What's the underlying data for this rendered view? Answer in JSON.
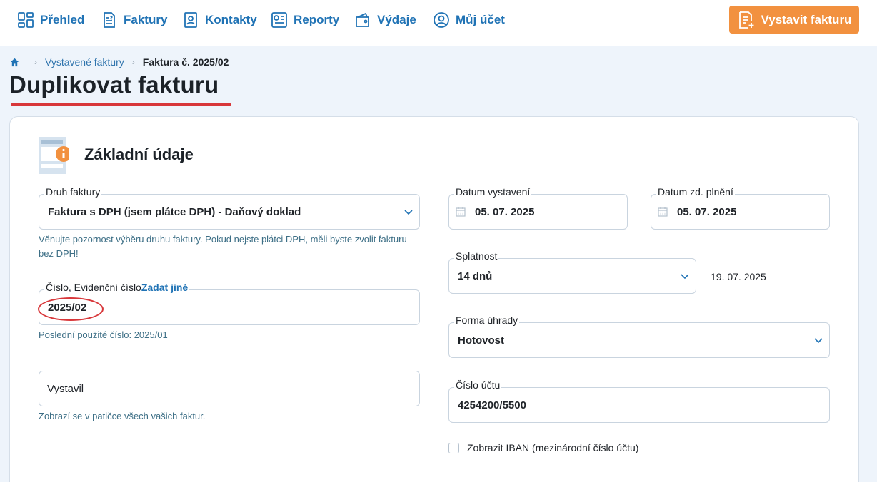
{
  "nav": {
    "items": [
      {
        "label": "Přehled",
        "icon": "dashboard-icon"
      },
      {
        "label": "Faktury",
        "icon": "invoice-icon"
      },
      {
        "label": "Kontakty",
        "icon": "contact-icon"
      },
      {
        "label": "Reporty",
        "icon": "report-icon"
      },
      {
        "label": "Výdaje",
        "icon": "wallet-icon"
      },
      {
        "label": "Můj účet",
        "icon": "user-icon"
      }
    ],
    "cta_label": "Vystavit fakturu"
  },
  "breadcrumb": {
    "link": "Vystavené faktury",
    "current": "Faktura č. 2025/02"
  },
  "page": {
    "title": "Duplikovat fakturu"
  },
  "section": {
    "title": "Základní údaje"
  },
  "form": {
    "invoice_type": {
      "label": "Druh faktury",
      "value": "Faktura s DPH (jsem plátce DPH) - Daňový doklad",
      "help": "Věnujte pozornost výběru druhu faktury. Pokud nejste plátci DPH, měli byste zvolit fakturu bez DPH!"
    },
    "number": {
      "label": "Číslo, Evidenční číslo",
      "link": "Zadat jiné",
      "value": "2025/02",
      "help": "Poslední použité číslo: 2025/01"
    },
    "issuer": {
      "placeholder": "Vystavil",
      "help": "Zobrazí se v patičce všech vašich faktur."
    },
    "issue_date": {
      "label": "Datum vystavení",
      "value": "05. 07. 2025"
    },
    "taxable_date": {
      "label": "Datum zd. plnění",
      "value": "05. 07. 2025"
    },
    "due": {
      "label": "Splatnost",
      "value": "14 dnů",
      "date": "19. 07. 2025"
    },
    "payment": {
      "label": "Forma úhrady",
      "value": "Hotovost"
    },
    "account": {
      "label": "Číslo účtu",
      "value": "4254200/5500"
    },
    "iban": {
      "label": "Zobrazit IBAN (mezinárodní číslo účtu)",
      "checked": false
    }
  },
  "colors": {
    "nav_text": "#2073b5",
    "cta": "#f2913f",
    "annotation": "#d8373a",
    "help_text": "#3d6f86"
  }
}
